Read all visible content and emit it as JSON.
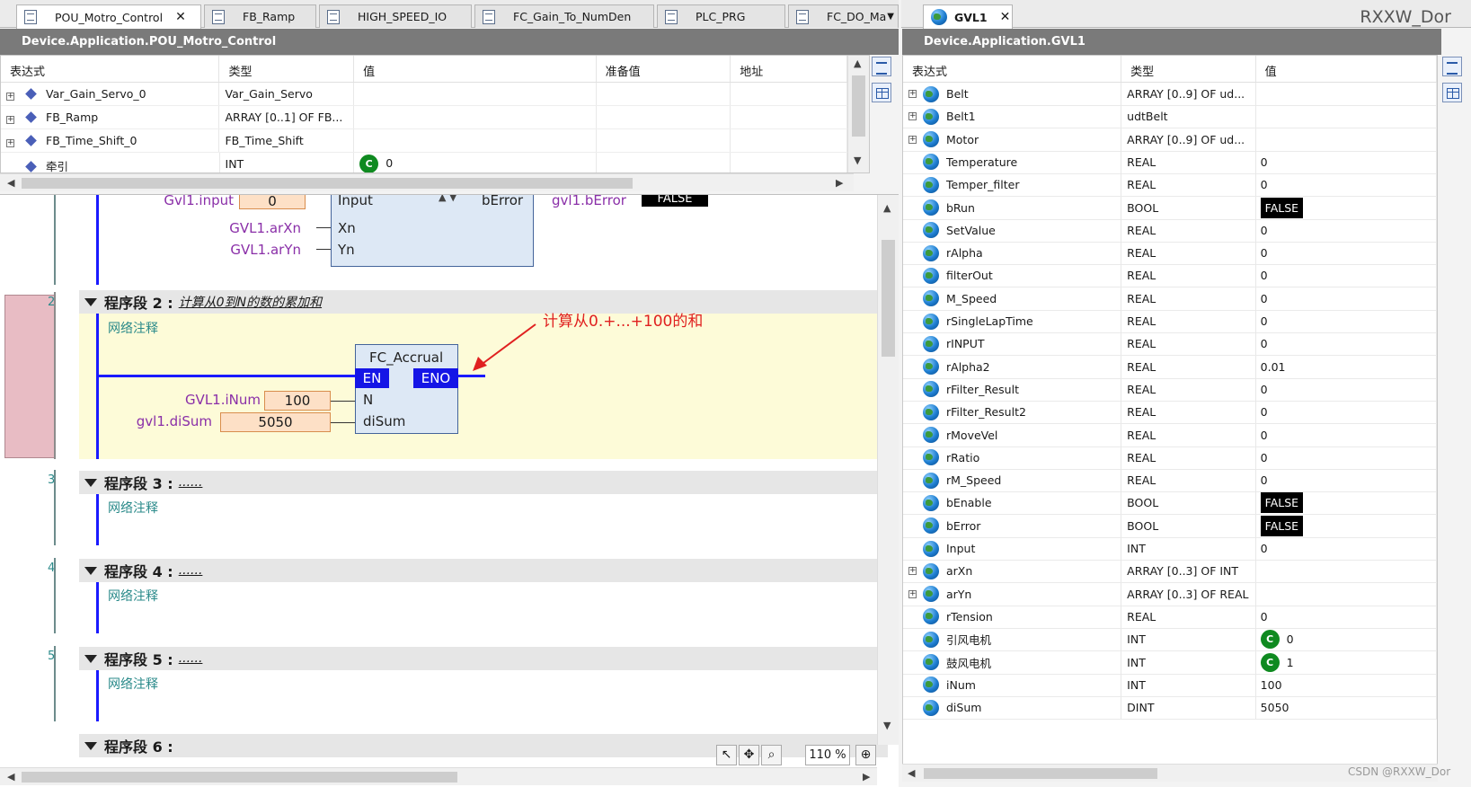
{
  "tabs_left": [
    {
      "label": "POU_Motro_Control",
      "active": true,
      "closable": true
    },
    {
      "label": "FB_Ramp"
    },
    {
      "label": "HIGH_SPEED_IO"
    },
    {
      "label": "FC_Gain_To_NumDen"
    },
    {
      "label": "PLC_PRG"
    },
    {
      "label": "FC_DO_Ma"
    }
  ],
  "tabs_right": [
    {
      "label": "GVL1",
      "active": true,
      "closable": true
    }
  ],
  "top_right_text": "RXXW_Dor",
  "left_pane": {
    "path": "Device.Application.POU_Motro_Control",
    "columns": [
      "表达式",
      "类型",
      "值",
      "准备值",
      "地址"
    ],
    "rows": [
      {
        "expr": "Var_Gain_Servo_0",
        "type": "Var_Gain_Servo",
        "value": "",
        "expandable": true
      },
      {
        "expr": "FB_Ramp",
        "type": "ARRAY [0..1] OF FB...",
        "value": "",
        "expandable": true
      },
      {
        "expr": "FB_Time_Shift_0",
        "type": "FB_Time_Shift",
        "value": "",
        "expandable": true
      },
      {
        "expr": "牵引",
        "type": "INT",
        "value": "0",
        "badge": "C",
        "expandable": false
      }
    ]
  },
  "editor": {
    "net1": {
      "input_var": "Gvl1.input",
      "input_val": "0",
      "input_pin": "Input",
      "xn_var": "GVL1.arXn",
      "xn_pin": "Xn",
      "yn_var": "GVL1.arYn",
      "yn_pin": "Yn",
      "out_pin": "bError",
      "out_var": "gvl1.bError",
      "out_val": "FALSE"
    },
    "net2": {
      "number": "2",
      "title": "程序段  2 :",
      "comment": "计算从0到N的数的累加和",
      "note": "网络注释",
      "block_name": "FC_Accrual",
      "en": "EN",
      "eno": "ENO",
      "n_var": "GVL1.iNum",
      "n_val": "100",
      "n_pin": "N",
      "d_var": "gvl1.diSum",
      "d_val": "5050",
      "d_pin": "diSum",
      "annotation": "计算从0.+...+100的和"
    },
    "net3": {
      "number": "3",
      "title": "程序段  3 :",
      "comment": "......",
      "note": "网络注释"
    },
    "net4": {
      "number": "4",
      "title": "程序段  4 :",
      "comment": "......",
      "note": "网络注释"
    },
    "net5": {
      "number": "5",
      "title": "程序段  5 :",
      "comment": "......",
      "note": "网络注释"
    },
    "net6": {
      "number": "6",
      "title": "程序段  6 :"
    },
    "zoom": "110 %"
  },
  "right_pane": {
    "path": "Device.Application.GVL1",
    "columns": [
      "表达式",
      "类型",
      "值"
    ],
    "rows": [
      {
        "expr": "Belt",
        "type": "ARRAY [0..9] OF ud...",
        "value": "",
        "expandable": true
      },
      {
        "expr": "Belt1",
        "type": "udtBelt",
        "value": "",
        "expandable": true
      },
      {
        "expr": "Motor",
        "type": "ARRAY [0..9] OF ud...",
        "value": "",
        "expandable": true
      },
      {
        "expr": "Temperature",
        "type": "REAL",
        "value": "0"
      },
      {
        "expr": "Temper_filter",
        "type": "REAL",
        "value": "0"
      },
      {
        "expr": "bRun",
        "type": "BOOL",
        "value": "FALSE",
        "bool": true
      },
      {
        "expr": "SetValue",
        "type": "REAL",
        "value": "0"
      },
      {
        "expr": "rAlpha",
        "type": "REAL",
        "value": "0"
      },
      {
        "expr": "filterOut",
        "type": "REAL",
        "value": "0"
      },
      {
        "expr": "M_Speed",
        "type": "REAL",
        "value": "0"
      },
      {
        "expr": "rSingleLapTime",
        "type": "REAL",
        "value": "0"
      },
      {
        "expr": "rINPUT",
        "type": "REAL",
        "value": "0"
      },
      {
        "expr": "rAlpha2",
        "type": "REAL",
        "value": "0.01"
      },
      {
        "expr": "rFilter_Result",
        "type": "REAL",
        "value": "0"
      },
      {
        "expr": "rFilter_Result2",
        "type": "REAL",
        "value": "0"
      },
      {
        "expr": "rMoveVel",
        "type": "REAL",
        "value": "0"
      },
      {
        "expr": "rRatio",
        "type": "REAL",
        "value": "0"
      },
      {
        "expr": "rM_Speed",
        "type": "REAL",
        "value": "0"
      },
      {
        "expr": "bEnable",
        "type": "BOOL",
        "value": "FALSE",
        "bool": true
      },
      {
        "expr": "bError",
        "type": "BOOL",
        "value": "FALSE",
        "bool": true
      },
      {
        "expr": "Input",
        "type": "INT",
        "value": "0"
      },
      {
        "expr": "arXn",
        "type": "ARRAY [0..3] OF INT",
        "value": "",
        "expandable": true
      },
      {
        "expr": "arYn",
        "type": "ARRAY [0..3] OF REAL",
        "value": "",
        "expandable": true
      },
      {
        "expr": "rTension",
        "type": "REAL",
        "value": "0"
      },
      {
        "expr": "引风电机",
        "type": "INT",
        "value": "0",
        "badge": "C"
      },
      {
        "expr": "鼓风电机",
        "type": "INT",
        "value": "1",
        "badge": "C"
      },
      {
        "expr": "iNum",
        "type": "INT",
        "value": "100"
      },
      {
        "expr": "diSum",
        "type": "DINT",
        "value": "5050"
      }
    ]
  },
  "watermark": "CSDN @RXXW_Dor"
}
